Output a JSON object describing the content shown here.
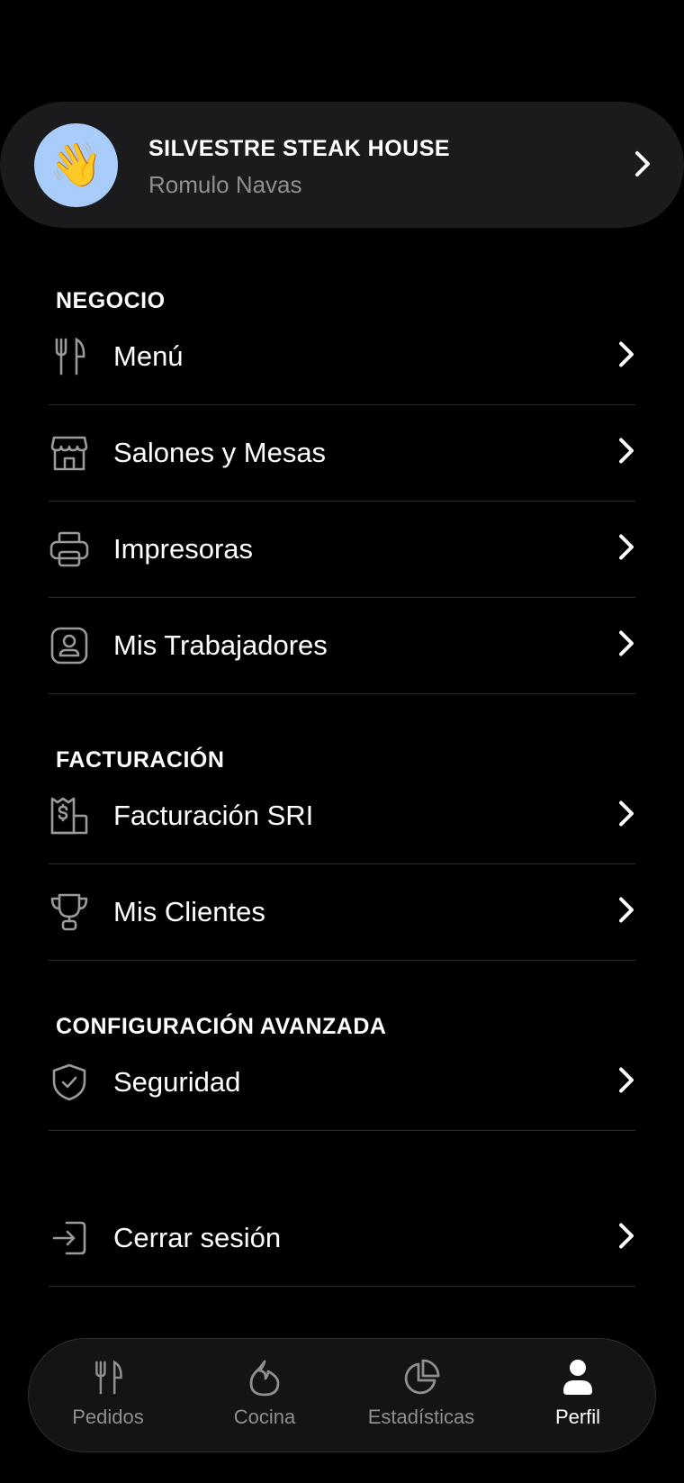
{
  "profile": {
    "business_name": "SILVESTRE STEAK HOUSE",
    "user_name": "Romulo Navas",
    "avatar_emoji": "👋",
    "avatar_bg": "#a9cdfb"
  },
  "sections": {
    "negocio": {
      "title": "NEGOCIO",
      "items": [
        {
          "label": "Menú",
          "icon": "fork-knife-icon"
        },
        {
          "label": "Salones y Mesas",
          "icon": "store-icon"
        },
        {
          "label": "Impresoras",
          "icon": "printer-icon"
        },
        {
          "label": "Mis Trabajadores",
          "icon": "id-badge-icon"
        }
      ]
    },
    "facturacion": {
      "title": "FACTURACIÓN",
      "items": [
        {
          "label": "Facturación SRI",
          "icon": "receipt-dollar-icon"
        },
        {
          "label": "Mis Clientes",
          "icon": "trophy-icon"
        }
      ]
    },
    "avanzada": {
      "title": "CONFIGURACIÓN AVANZADA",
      "items": [
        {
          "label": "Seguridad",
          "icon": "shield-check-icon"
        }
      ]
    }
  },
  "logout": {
    "label": "Cerrar sesión",
    "icon": "logout-icon"
  },
  "bottom_nav": {
    "items": [
      {
        "label": "Pedidos",
        "icon": "fork-knife-icon",
        "active": false
      },
      {
        "label": "Cocina",
        "icon": "flame-icon",
        "active": false
      },
      {
        "label": "Estadísticas",
        "icon": "pie-chart-icon",
        "active": false
      },
      {
        "label": "Perfil",
        "icon": "user-icon",
        "active": true
      }
    ]
  },
  "colors": {
    "background": "#000000",
    "card": "#1b1b1d",
    "muted_text": "#8e8e93",
    "divider": "#2a2a2c"
  }
}
